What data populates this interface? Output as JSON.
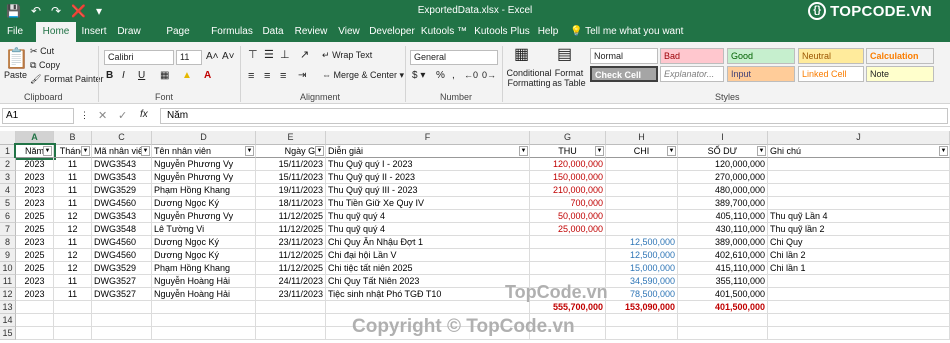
{
  "titlebar": {
    "title": "ExportedData.xlsx  -  Excel",
    "logo_text": "TOPCODE.VN"
  },
  "tabs": [
    "File",
    "Home",
    "Insert",
    "Draw",
    "Page Layout",
    "Formulas",
    "Data",
    "Review",
    "View",
    "Developer",
    "Kutools ™",
    "Kutools Plus",
    "Help",
    "Tell me what you want to do"
  ],
  "ribbon": {
    "paste": "Paste",
    "cut": "Cut",
    "copy": "Copy",
    "format_painter": "Format Painter",
    "clipboard": "Clipboard",
    "font_name": "Calibri",
    "font_size": "11",
    "font": "Font",
    "wrap_text": "Wrap Text",
    "merge_center": "Merge & Center",
    "alignment": "Alignment",
    "number_format": "General",
    "number": "Number",
    "conditional_formatting": "Conditional Formatting",
    "format_as_table": "Format as Table",
    "styles": "Styles",
    "style_cells": [
      "Normal",
      "Bad",
      "Good",
      "Neutral",
      "Calculation",
      "Check Cell",
      "Explanator...",
      "Input",
      "Linked Cell",
      "Note"
    ],
    "colors": {
      "bad_bg": "#ffc7ce",
      "good_bg": "#c6efce",
      "neutral_bg": "#ffeb9c",
      "calc_bg": "#f2f2f2",
      "check_bg": "#a5a5a5",
      "input_bg": "#ffcc99",
      "note_bg": "#ffffcc"
    }
  },
  "formula_bar": {
    "name_box": "A1",
    "fx": "fx",
    "content": "Năm"
  },
  "columns": [
    "A",
    "B",
    "C",
    "D",
    "E",
    "F",
    "G",
    "H",
    "I",
    "J"
  ],
  "headers": [
    "Năm",
    "Tháng",
    "Mã nhân viên",
    "Tên nhân viên",
    "Ngày Giờ",
    "Diễn giải",
    "THU",
    "CHI",
    "SỐ DƯ",
    "Ghi chú"
  ],
  "rows": [
    [
      "2023",
      "11",
      "DWG3543",
      "Nguyễn Phương Vy",
      "15/11/2023",
      "Thu Quỹ quý I - 2023",
      "120,000,000",
      "",
      "120,000,000",
      ""
    ],
    [
      "2023",
      "11",
      "DWG3543",
      "Nguyễn Phương Vy",
      "15/11/2023",
      "Thu Quỹ quý II - 2023",
      "150,000,000",
      "",
      "270,000,000",
      ""
    ],
    [
      "2023",
      "11",
      "DWG3529",
      "Phạm Hồng Khang",
      "19/11/2023",
      "Thu Quỹ quý III - 2023",
      "210,000,000",
      "",
      "480,000,000",
      ""
    ],
    [
      "2023",
      "11",
      "DWG4560",
      "Dương Ngọc Ký",
      "18/11/2023",
      "Thu Tiền Giữ Xe Quy IV",
      "700,000",
      "",
      "389,700,000",
      ""
    ],
    [
      "2025",
      "12",
      "DWG3543",
      "Nguyễn Phương Vy",
      "11/12/2025",
      "Thu quỹ quý 4",
      "50,000,000",
      "",
      "405,110,000",
      "Thu quỹ Lần 4"
    ],
    [
      "2025",
      "12",
      "DWG3548",
      "Lê Tường Vi",
      "11/12/2025",
      "Thu quỹ quý 4",
      "25,000,000",
      "",
      "430,110,000",
      "Thu quỹ lần 2"
    ],
    [
      "2023",
      "11",
      "DWG4560",
      "Dương Ngọc Ký",
      "23/11/2023",
      "Chi Quy Ăn Nhậu Đợt 1",
      "",
      "12,500,000",
      "389,000,000",
      "Chi Quy"
    ],
    [
      "2025",
      "12",
      "DWG4560",
      "Dương Ngọc Ký",
      "11/12/2025",
      "Chi đại hội Lần V",
      "",
      "12,500,000",
      "402,610,000",
      "Chi lần 2"
    ],
    [
      "2025",
      "12",
      "DWG3529",
      "Phạm Hồng Khang",
      "11/12/2025",
      "Chi tiệc tất niên 2025",
      "",
      "15,000,000",
      "415,110,000",
      "Chi lần 1"
    ],
    [
      "2023",
      "11",
      "DWG3527",
      "Nguyễn Hoàng Hải",
      "24/11/2023",
      "Chi Quy Tất Niên 2023",
      "",
      "34,590,000",
      "355,110,000",
      ""
    ],
    [
      "2023",
      "11",
      "DWG3527",
      "Nguyễn Hoàng Hải",
      "23/11/2023",
      "Tiệc sinh nhật Phó TGĐ T10",
      "",
      "78,500,000",
      "401,500,000",
      ""
    ],
    [
      "",
      "",
      "",
      "",
      "",
      "",
      "555,700,000",
      "153,090,000",
      "401,500,000",
      ""
    ]
  ],
  "row_numbers": [
    "1",
    "2",
    "3",
    "4",
    "5",
    "6",
    "7",
    "8",
    "9",
    "10",
    "11",
    "12",
    "13",
    "14",
    "15"
  ],
  "watermarks": [
    "TopCode.vn",
    "Copyright © TopCode.vn"
  ]
}
